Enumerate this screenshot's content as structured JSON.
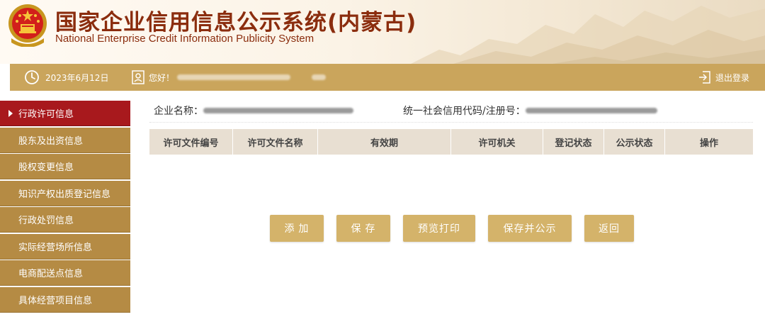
{
  "header": {
    "title_cn": "国家企业信用信息公示系统(内蒙古)",
    "title_en": "National Enterprise Credit Information Publicity System"
  },
  "infobar": {
    "date": "2023年6月12日",
    "greeting": "您好！",
    "logout": "退出登录",
    "icons": [
      "clock-icon",
      "user-icon",
      "logout-icon"
    ]
  },
  "sidebar": {
    "items": [
      {
        "label": "行政许可信息",
        "active": true
      },
      {
        "label": "股东及出资信息",
        "active": false
      },
      {
        "label": "股权变更信息",
        "active": false
      },
      {
        "label": "知识产权出质登记信息",
        "active": false
      },
      {
        "label": "行政处罚信息",
        "active": false
      },
      {
        "label": "实际经营场所信息",
        "active": false
      },
      {
        "label": "电商配送点信息",
        "active": false
      },
      {
        "label": "具体经营项目信息",
        "active": false
      }
    ]
  },
  "main": {
    "company_label": "企业名称：",
    "credit_code_label": "统一社会信用代码/注册号：",
    "table": {
      "headers": [
        "许可文件编号",
        "许可文件名称",
        "有效期",
        "许可机关",
        "登记状态",
        "公示状态",
        "操作"
      ],
      "rows": []
    },
    "buttons": {
      "add": "添 加",
      "save": "保 存",
      "preview_print": "预览打印",
      "save_publish": "保存并公示",
      "back": "返回"
    }
  },
  "colors": {
    "accent_gold": "#caa55c",
    "sidebar_gold": "#b58b44",
    "active_red": "#a8191d",
    "title_brown": "#8b2d0e",
    "button_gold": "#d4b36a"
  }
}
